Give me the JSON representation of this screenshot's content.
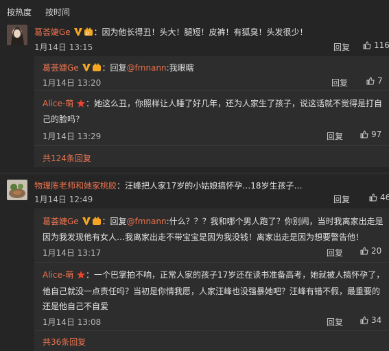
{
  "tabs": [
    {
      "label": "按热度"
    },
    {
      "label": "按时间"
    }
  ],
  "comment1": {
    "user": "葛荟婕Ge",
    "text": "：因为他长得丑！头大！腿短！皮裤！有狐臭！头发很少！",
    "time": "1月14日 13:15",
    "reply_label": "回复",
    "likes": "116",
    "replies": [
      {
        "user": "葛荟婕Ge",
        "prefix": "：回复",
        "at": "@fmnann",
        "text": ":我眼瞎",
        "time": "1月14日 13:20",
        "reply_label": "回复",
        "likes": "7"
      },
      {
        "user": "Alice-萌",
        "text1": "：她这么丑，你照样让人睡了好几年，还为人家生了孩子，说这话就不觉得是打自",
        "text2": "己的脸吗？",
        "time": "1月14日 13:29",
        "reply_label": "回复",
        "likes": "97"
      }
    ],
    "more": "共124条回复"
  },
  "comment2": {
    "user": "物理陈老师和她家桃胶",
    "text": "：汪峰把人家17岁的小姑娘搞怀孕…18岁生孩子…",
    "time": "1月14日 12:49",
    "reply_label": "回复",
    "likes": "46",
    "replies": [
      {
        "user": "葛荟婕Ge",
        "prefix": "：回复",
        "at": "@fmnann",
        "text1": ":什么？？？我和哪个男人跑了？你别闹，当时我离家出走是",
        "text2": "因为我发现他有女人…我离家出走不带宝宝是因为我没钱！离家出走是因为想要警告他！",
        "time": "1月14日 13:17",
        "reply_label": "回复",
        "likes": "20"
      },
      {
        "user": "Alice-萌",
        "text1": "：一个巴掌拍不响，正常人家的孩子17岁还在读书准备高考，她就被人搞怀孕了，",
        "text2": "他自己就没一点责任吗？当初是你情我愿，人家汪峰也没强暴她吧？汪峰有错不假，最重要的",
        "text3": "还是他自己不自爱",
        "time": "1月14日 13:08",
        "reply_label": "回复",
        "likes": "34"
      }
    ],
    "more": "共36条回复"
  },
  "colors": {
    "accent": "#eb7350",
    "background": "#252525",
    "reply_background": "#2d2d2d",
    "vip": "#f5a623"
  }
}
